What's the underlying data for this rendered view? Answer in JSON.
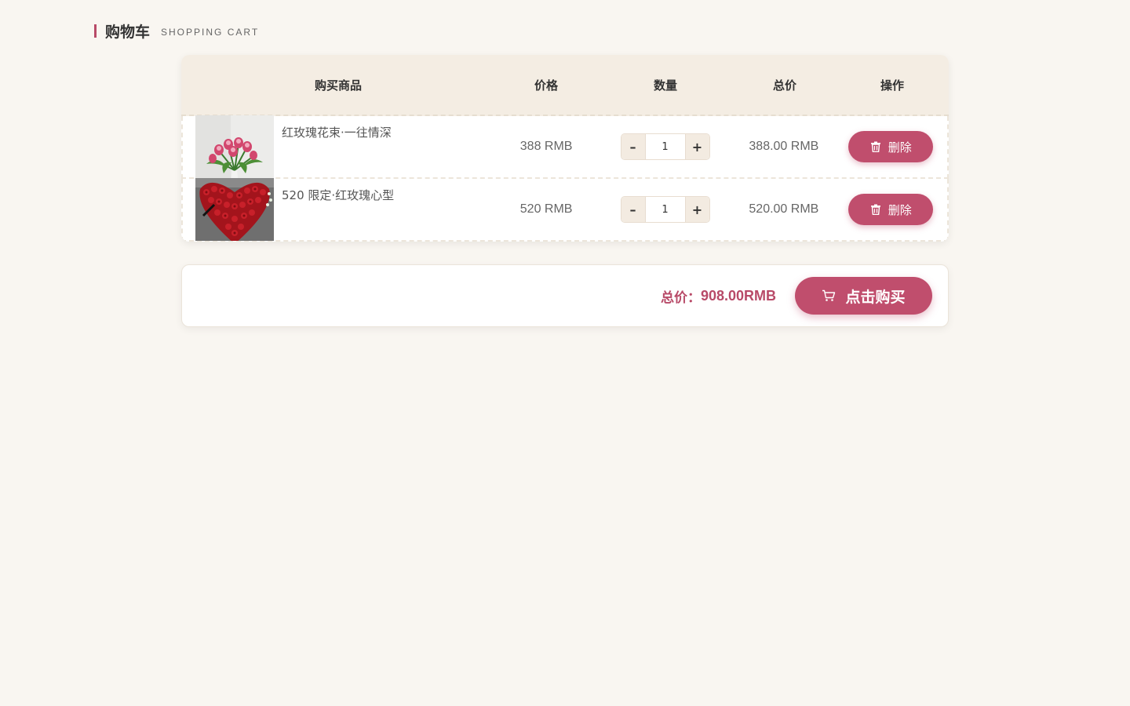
{
  "header": {
    "title": "购物车",
    "subtitle": "SHOPPING CART",
    "accent_color": "#b84a68"
  },
  "table": {
    "columns": [
      "购买商品",
      "价格",
      "数量",
      "总价",
      "操作"
    ],
    "rows": [
      {
        "name": "红玫瑰花束·一往情深",
        "price": "388 RMB",
        "quantity": "1",
        "total": "388.00 RMB",
        "delete_label": "删除",
        "image": "pink-tulip-bouquet"
      },
      {
        "name": "520 限定·红玫瑰心型",
        "price": "520 RMB",
        "quantity": "1",
        "total": "520.00 RMB",
        "delete_label": "删除",
        "image": "red-rose-heart"
      }
    ],
    "minus_label": "–",
    "plus_label": "+"
  },
  "summary": {
    "total_label": "总价：",
    "total_value": "908.00RMB",
    "buy_label": "点击购买"
  },
  "colors": {
    "primary": "#c04e6d",
    "background": "#f9f6f1",
    "header_bg": "#f4ede3"
  }
}
